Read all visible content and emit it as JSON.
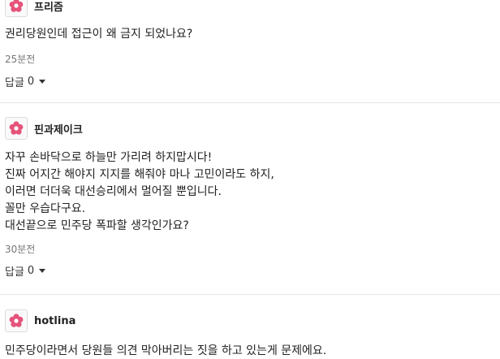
{
  "comments": [
    {
      "nickname": "프리즘",
      "lines": [
        "권리당원인데 접근이 왜 금지 되었나요?"
      ],
      "time": "25분전",
      "reply_label": "답글",
      "reply_count": "0"
    },
    {
      "nickname": "핀과제이크",
      "lines": [
        "자꾸 손바닥으로 하늘만 가리려 하지맙시다!",
        "진짜 어지간 해야지 지지를 해줘야 마나 고민이라도 하지,",
        "이러면 더더욱 대선승리에서 멀어질 뿐입니다.",
        "꼴만 우습다구요.",
        "대선끝으로 민주당 폭파할 생각인가요?"
      ],
      "time": "30분전",
      "reply_label": "답글",
      "reply_count": "0"
    },
    {
      "nickname": "hotlina",
      "lines": [
        "민주당이라면서 당원들 의견 막아버리는 짓을 하고 있는게 문제에요."
      ]
    }
  ],
  "icons": {
    "avatar": "flower-avatar-icon",
    "dropdown": "caret-down-icon"
  },
  "colors": {
    "avatar_flower": "#e5537a",
    "flower_center": "#ffffff"
  }
}
